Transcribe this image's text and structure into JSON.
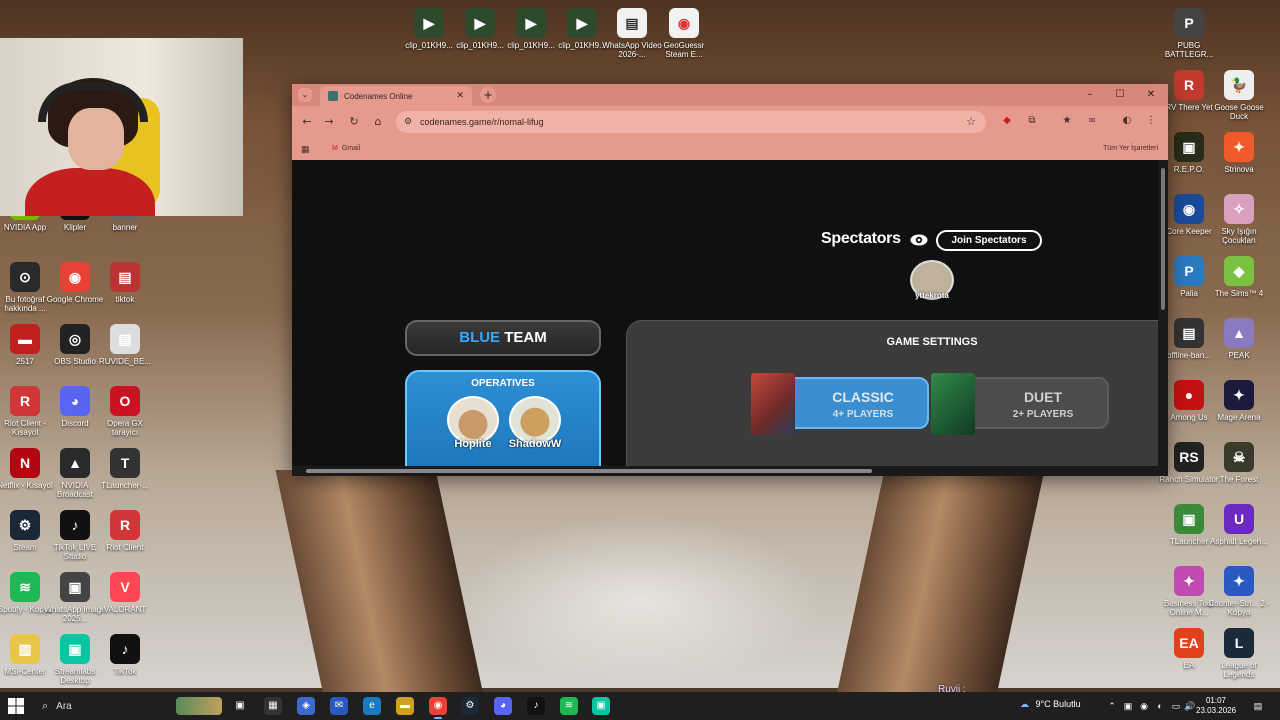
{
  "desktop": {
    "top_files": [
      {
        "label": "clip_01KH9...",
        "icon": "video-file-icon"
      },
      {
        "label": "clip_01KH9...",
        "icon": "video-file-icon"
      },
      {
        "label": "clip_01KH9...",
        "icon": "video-file-icon"
      },
      {
        "label": "clip_01KH9...",
        "icon": "video-file-icon"
      },
      {
        "label": "WhatsApp Video 2026-...",
        "icon": "document-icon"
      },
      {
        "label": "GeoGuessr Steam E...",
        "icon": "map-pin-icon"
      }
    ],
    "left_icons": [
      {
        "label": "NVIDIA App",
        "color": "#76b900",
        "glyph": "N"
      },
      {
        "label": "Klipler",
        "color": "#111111",
        "glyph": "✂"
      },
      {
        "label": "banner",
        "color": "#666666",
        "glyph": ""
      },
      {
        "label": "Bu fotoğraf hakkında ...",
        "color": "#2a2a2a",
        "glyph": "⊙"
      },
      {
        "label": "Google Chrome",
        "color": "#e94235",
        "glyph": "◉"
      },
      {
        "label": "tiktok",
        "color": "#bb3333",
        "glyph": "▤"
      },
      {
        "label": "2517",
        "color": "#c02020",
        "glyph": "▬"
      },
      {
        "label": "OBS Studio",
        "color": "#222222",
        "glyph": "◎"
      },
      {
        "label": "RUVIDE_BE...",
        "color": "#dddddd",
        "glyph": "▤"
      },
      {
        "label": "Riot Client - Kısayol",
        "color": "#d13639",
        "glyph": "R"
      },
      {
        "label": "Discord",
        "color": "#5865f2",
        "glyph": "◕"
      },
      {
        "label": "Opera GX tarayıcı",
        "color": "#cc1122",
        "glyph": "O"
      },
      {
        "label": "Netflix - Kısayol",
        "color": "#b20710",
        "glyph": "N"
      },
      {
        "label": "NVIDIA Broadcast",
        "color": "#2a2a2a",
        "glyph": "▲"
      },
      {
        "label": "TLauncher-...",
        "color": "#333333",
        "glyph": "T"
      },
      {
        "label": "Steam",
        "color": "#1b2838",
        "glyph": "⚙"
      },
      {
        "label": "TikTok LIVE Studio",
        "color": "#111111",
        "glyph": "♪"
      },
      {
        "label": "Riot Client",
        "color": "#d13639",
        "glyph": "R"
      },
      {
        "label": "Spotify - Kopya",
        "color": "#1db954",
        "glyph": "≋"
      },
      {
        "label": "WhatsApp Image 2025...",
        "color": "#444444",
        "glyph": "▣"
      },
      {
        "label": "VALORANT",
        "color": "#ff4655",
        "glyph": "V"
      },
      {
        "label": "MSI-Center",
        "color": "#e8c64a",
        "glyph": "▥"
      },
      {
        "label": "Streamlabs Desktop",
        "color": "#09c6a2",
        "glyph": "▣"
      },
      {
        "label": "TikTok",
        "color": "#111111",
        "glyph": "♪"
      }
    ],
    "right_icons": [
      {
        "label": "PUBG BATTLEGR...",
        "color": "#444444",
        "glyph": "P"
      },
      {
        "label": "RV There Yet",
        "color": "#c23a2e",
        "glyph": "R"
      },
      {
        "label": "Goose Goose Duck",
        "color": "#eeeeee",
        "glyph": "🦆"
      },
      {
        "label": "R.E.P.O.",
        "color": "#2a2a1a",
        "glyph": "▣"
      },
      {
        "label": "Strinova",
        "color": "#f05a2a",
        "glyph": "✦"
      },
      {
        "label": "Core Keeper",
        "color": "#1a4a9a",
        "glyph": "◉"
      },
      {
        "label": "Sky Işığın Çocukları",
        "color": "#d9a0c0",
        "glyph": "✧"
      },
      {
        "label": "Palia",
        "color": "#2a7ac0",
        "glyph": "P"
      },
      {
        "label": "The Sims™ 4",
        "color": "#7ac142",
        "glyph": "◆"
      },
      {
        "label": "offline-ban...",
        "color": "#333333",
        "glyph": "▤"
      },
      {
        "label": "PEAK",
        "color": "#8a7ac0",
        "glyph": "▲"
      },
      {
        "label": "Among Us",
        "color": "#c51111",
        "glyph": "●"
      },
      {
        "label": "Mage Arena",
        "color": "#1a1a3a",
        "glyph": "✦"
      },
      {
        "label": "Ranch Simulator",
        "color": "#222222",
        "glyph": "RS"
      },
      {
        "label": "The Forest",
        "color": "#3a3a2a",
        "glyph": "☠"
      },
      {
        "label": "TLauncher",
        "color": "#3a8a3a",
        "glyph": "▣"
      },
      {
        "label": "Asphalt Legen...",
        "color": "#6a2ac0",
        "glyph": "U"
      },
      {
        "label": "Business Tour Online M...",
        "color": "#c04ab0",
        "glyph": "✦"
      },
      {
        "label": "Counter-Stri... 2 - Kopya",
        "color": "#2a5ac0",
        "glyph": "✦"
      },
      {
        "label": "EA",
        "color": "#e0401a",
        "glyph": "EA"
      },
      {
        "label": "League of Legends",
        "color": "#1a2a3a",
        "glyph": "L"
      }
    ]
  },
  "browser": {
    "tab_title": "Codenames Online",
    "url": "codenames.game/r/nomal-lifug",
    "bookmark_gmail": "Gmail",
    "bookmark_all": "Tüm Yer İşaretleri"
  },
  "game": {
    "spectators_title": "Spectators",
    "join_spectators": "Join Spectators",
    "spectator_name": "yttekrota",
    "blue_word": "BLUE",
    "team_word": "TEAM",
    "operatives_label": "OPERATIVES",
    "operatives": [
      "Hoplite",
      "ShadowW"
    ],
    "settings_title": "GAME SETTINGS",
    "modes": [
      {
        "name": "CLASSIC",
        "players": "4+ PLAYERS",
        "selected": true
      },
      {
        "name": "DUET",
        "players": "2+ PLAYERS",
        "selected": false
      }
    ]
  },
  "overlay": {
    "ruvij": "Ruvij :"
  },
  "taskbar": {
    "search_placeholder": "Ara",
    "weather": "9°C  Bulutlu",
    "time": "01:07",
    "date": "23.03.2026"
  },
  "colors": {
    "blue_team": "#39a7ff",
    "browser_frame": "#d8877b",
    "page_bg": "#101010"
  }
}
